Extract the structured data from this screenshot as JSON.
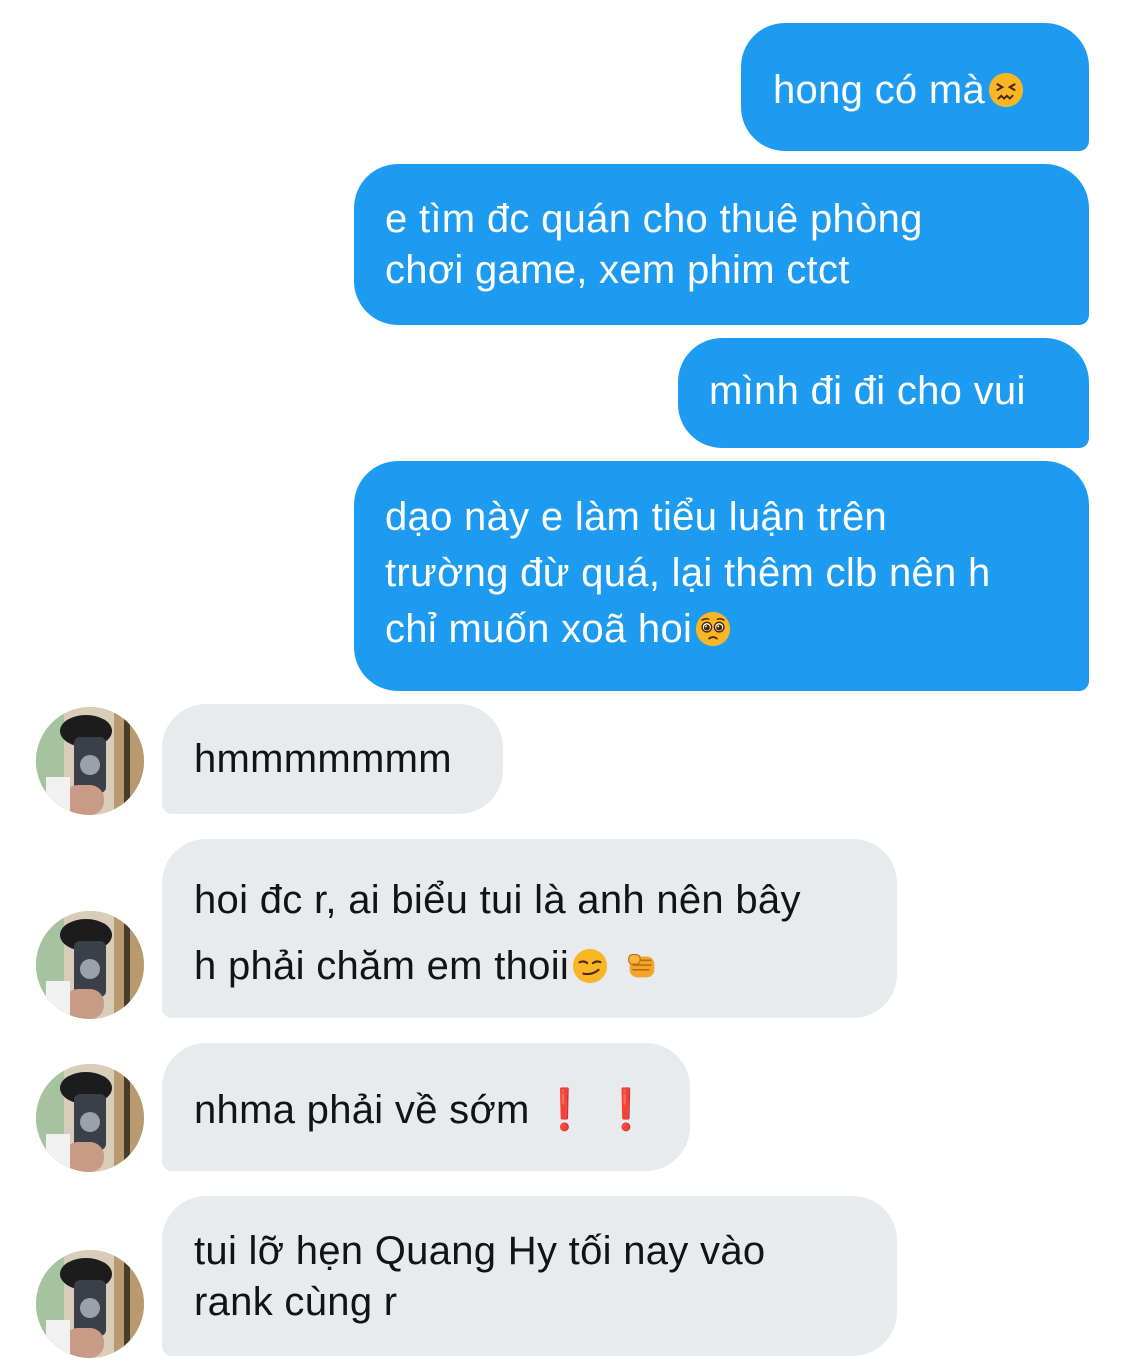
{
  "conversation": {
    "messages": [
      {
        "side": "sent",
        "text": "hong có mà",
        "emoji": "confounded-face"
      },
      {
        "side": "sent",
        "text": "e tìm đc quán cho thuê phòng\nchơi game, xem phim ctct"
      },
      {
        "side": "sent",
        "text": "mình đi đi cho vui"
      },
      {
        "side": "sent",
        "text": "dạo này e làm tiểu luận trên\ntrường đừ quá, lại thêm clb nên h\nchỉ muốn xoã hoi",
        "emoji": "pleading-face"
      },
      {
        "side": "received",
        "text": "hmmmmmmm"
      },
      {
        "side": "received",
        "text": "hoi đc r, ai biểu tui là anh nên bây\nh phải chăm em thoii",
        "emoji": "smirking-face, oncoming-fist"
      },
      {
        "side": "received",
        "text": "nhma phải về sớm",
        "emoji": "exclamation-marks",
        "marks": "❗ ❗"
      },
      {
        "side": "received",
        "text": "tui lỡ hẹn Quang Hy tối nay vào\nrank cùng r"
      }
    ]
  },
  "colors": {
    "sent_bubble": "#1d9bf0",
    "sent_text": "#ffffff",
    "received_bubble": "#e8ebee",
    "received_text": "#0f1419",
    "exclamation": "#e0121b"
  }
}
